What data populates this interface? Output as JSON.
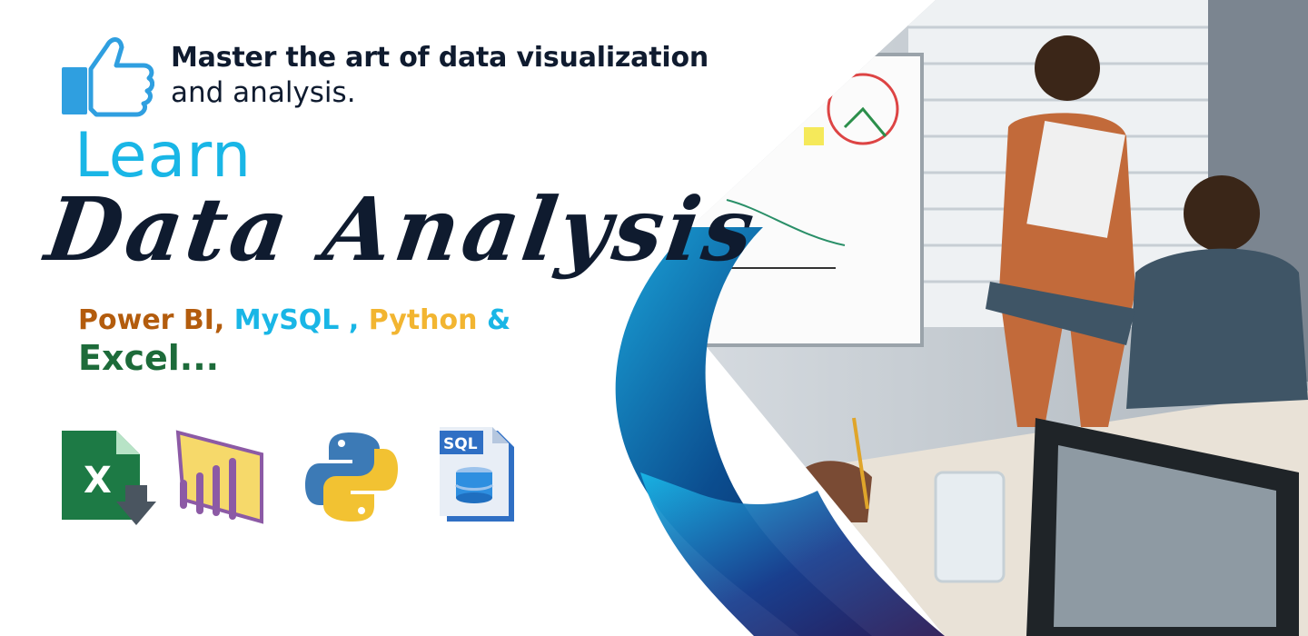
{
  "headline": {
    "line1": "Master the art of data visualization",
    "line2": "and analysis."
  },
  "learn": "Learn",
  "title": "Data Analysis",
  "tools": {
    "powerbi": "Power BI,",
    "mysql": "MySQL ,",
    "python": "Python",
    "amp": "&",
    "excel": "Excel..."
  },
  "icons": {
    "excel": "excel-icon",
    "powerbi": "power-bi-icon",
    "python": "python-icon",
    "sql": "sql-icon"
  },
  "colors": {
    "accent_blue": "#19b6e6",
    "navy": "#0f1b2f",
    "powerbi_brown": "#b35c0d",
    "python_yellow": "#f2b531",
    "excel_green": "#1d6b3a"
  }
}
